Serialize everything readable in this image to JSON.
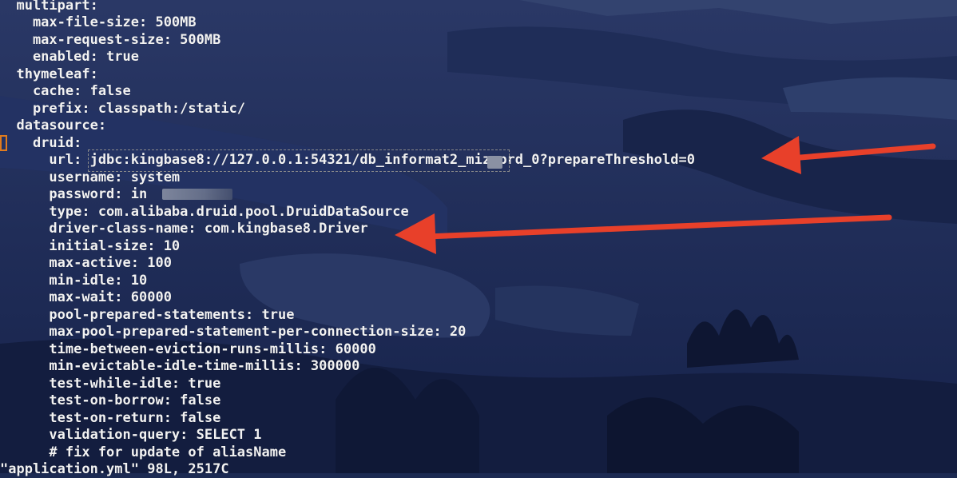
{
  "config_lines": [
    "  multipart:",
    "    max-file-size: 500MB",
    "    max-request-size: 500MB",
    "    enabled: true",
    "  thymeleaf:",
    "    cache: false",
    "    prefix: classpath:/static/",
    "  datasource:",
    "    druid:",
    "      url: jdbc:kingbase8://127.0.0.1:54321/db_informat2_miz_prd_0?prepareThreshold=0",
    "      username: system",
    "      password: in",
    "      type: com.alibaba.druid.pool.DruidDataSource",
    "      driver-class-name: com.kingbase8.Driver",
    "      initial-size: 10",
    "      max-active: 100",
    "      min-idle: 10",
    "      max-wait: 60000",
    "      pool-prepared-statements: true",
    "      max-pool-prepared-statement-per-connection-size: 20",
    "      time-between-eviction-runs-millis: 60000",
    "      min-evictable-idle-time-millis: 300000",
    "      test-while-idle: true",
    "      test-on-borrow: false",
    "      test-on-return: false",
    "      validation-query: SELECT 1",
    "      # fix for update of aliasName"
  ],
  "status_line": "\"application.yml\" 98L, 2517C",
  "colors": {
    "text": "#f2f2f2",
    "cursor": "#e07b1e",
    "arrow": "#e8402a",
    "background": "#1c2a52"
  }
}
